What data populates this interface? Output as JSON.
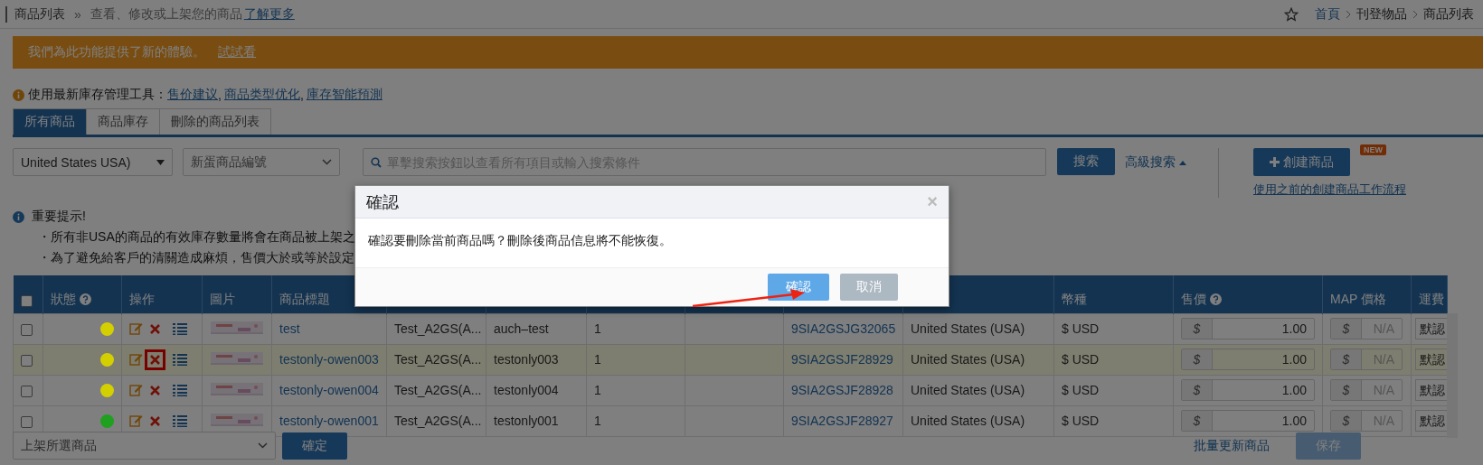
{
  "breadcrumb": {
    "title": "商品列表",
    "separator": "»",
    "description": "查看、修改或上架您的商品",
    "link": "了解更多"
  },
  "nav": {
    "items": [
      {
        "label": "首頁",
        "link": true
      },
      {
        "label": "刊登物品",
        "link": false
      },
      {
        "label": "商品列表",
        "link": false
      }
    ]
  },
  "banner": {
    "text": "我們為此功能提供了新的體驗。",
    "link": "試試看"
  },
  "tools": {
    "label": "使用最新庫存管理工具：",
    "separator": ",",
    "links": [
      "售价建议",
      "商品类型优化",
      "庫存智能預測"
    ]
  },
  "tabs": [
    {
      "label": "所有商品",
      "selected": true
    },
    {
      "label": "商品庫存",
      "selected": false
    },
    {
      "label": "刪除的商品列表",
      "selected": false
    }
  ],
  "filters": {
    "country": "United States USA)",
    "id_type": "新蛋商品編號",
    "search_placeholder": "單擊搜索按鈕以查看所有項目或輸入搜索條件",
    "search_button": "搜索",
    "advanced": "高級搜索",
    "create_button": "創建商品",
    "new_badge": "NEW",
    "old_flow_link": "使用之前的創建商品工作流程"
  },
  "notice": {
    "title": "重要提示!",
    "lines": [
      "・所有非USA的商品的有效庫存數量將會在商品被上架之",
      "・為了避免給客戶的清關造成麻煩，售價大於或等於設定"
    ]
  },
  "table": {
    "columns": [
      {
        "kind": "checkbox",
        "checked": false
      },
      {
        "kind": "text",
        "label": "狀態",
        "help": true
      },
      {
        "kind": "text",
        "label": "操作",
        "help": false
      },
      {
        "kind": "text",
        "label": "圖片",
        "help": false
      },
      {
        "kind": "text",
        "label": "商品標題",
        "help": false
      },
      {
        "kind": "text"
      },
      {
        "kind": "text"
      },
      {
        "kind": "text"
      },
      {
        "kind": "text"
      },
      {
        "kind": "text"
      },
      {
        "kind": "text"
      },
      {
        "kind": "text",
        "label": "幣種",
        "help": false
      },
      {
        "kind": "text",
        "label": "售價",
        "help": true
      },
      {
        "kind": "text",
        "label": "MAP 價格",
        "help": false
      },
      {
        "kind": "text",
        "label": "運費"
      }
    ],
    "rows": [
      {
        "checked": false,
        "highlighted": false,
        "color": "#d4d000",
        "delete_marked": false,
        "title": "test",
        "col_6": "Test_A2GS(A...",
        "col_7": "auch–test",
        "col_8": "1",
        "sku": "9SIA2GSJG32065",
        "country": "United States (USA)",
        "currency": "$ USD",
        "price_symbol": "$",
        "price": "1.00",
        "map_symbol": "$",
        "map_placeholder": "N/A",
        "shipping": "默認"
      },
      {
        "checked": false,
        "highlighted": true,
        "color": "#d4d000",
        "delete_marked": true,
        "title": "testonly-owen003",
        "col_6": "Test_A2GS(A...",
        "col_7": "testonly003",
        "col_8": "1",
        "sku": "9SIA2GSJF28929",
        "country": "United States (USA)",
        "currency": "$ USD",
        "price_symbol": "$",
        "price": "1.00",
        "map_symbol": "$",
        "map_placeholder": "N/A",
        "shipping": "默認"
      },
      {
        "checked": false,
        "highlighted": false,
        "color": "#d4d000",
        "delete_marked": false,
        "title": "testonly-owen004",
        "col_6": "Test_A2GS(A...",
        "col_7": "testonly004",
        "col_8": "1",
        "sku": "9SIA2GSJF28928",
        "country": "United States (USA)",
        "currency": "$ USD",
        "price_symbol": "$",
        "price": "1.00",
        "map_symbol": "$",
        "map_placeholder": "N/A",
        "shipping": "默認"
      },
      {
        "checked": false,
        "highlighted": false,
        "color": "#1fa01f",
        "delete_marked": false,
        "title": "testonly-owen001",
        "col_6": "Test_A2GS(A...",
        "col_7": "testonly001",
        "col_8": "1",
        "sku": "9SIA2GSJF28927",
        "country": "United States (USA)",
        "currency": "$ USD",
        "price_symbol": "$",
        "price": "1.00",
        "map_symbol": "$",
        "map_placeholder": "N/A",
        "shipping": "默認"
      }
    ]
  },
  "footer": {
    "bulk_action": "上架所選商品",
    "apply_button": "確定",
    "bulk_update_link": "批量更新商品",
    "save_button": "保存",
    "save_disabled": true
  },
  "dialog": {
    "title": "確認",
    "close": "×",
    "message": "確認要刪除當前商品嗎？刪除後商品信息將不能恢復。",
    "confirm": "確認",
    "cancel": "取消"
  }
}
